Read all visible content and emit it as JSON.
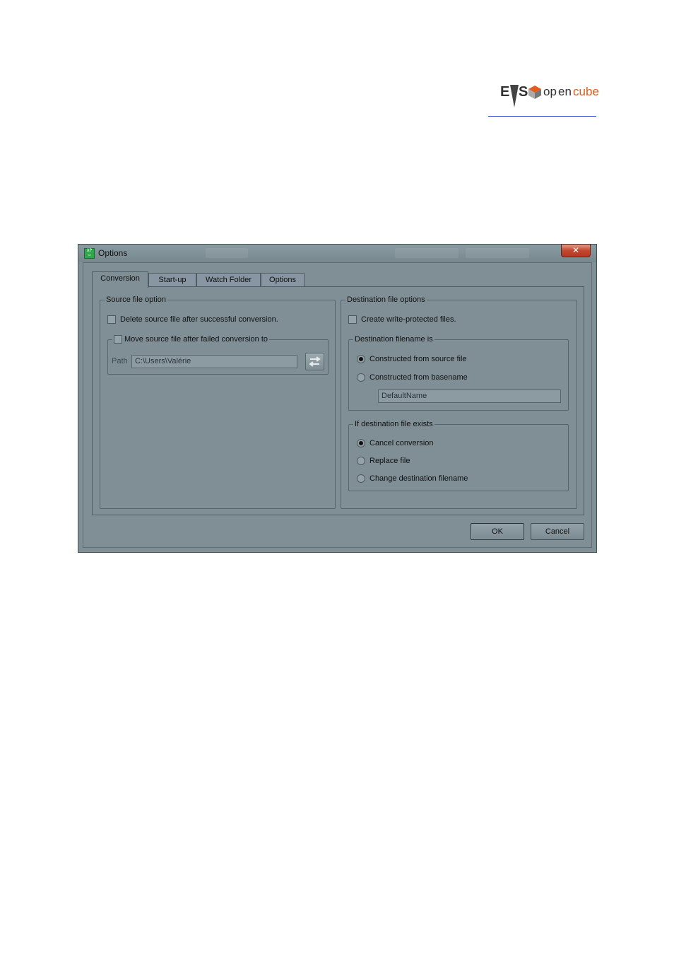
{
  "header": {
    "logo_alt": "EVS opencube"
  },
  "window": {
    "title": "Options",
    "close_label": "✕"
  },
  "tabs": [
    {
      "label": "Conversion",
      "active": true
    },
    {
      "label": "Start-up",
      "active": false
    },
    {
      "label": "Watch Folder",
      "active": false
    },
    {
      "label": "Options",
      "active": false
    }
  ],
  "source": {
    "group_label": "Source file option",
    "delete_label": "Delete source file after successful conversion.",
    "delete_checked": false,
    "move_label": "Move source file after failed conversion to",
    "move_checked": false,
    "path_label": "Path",
    "path_value": "C:\\Users\\Valérie"
  },
  "destination": {
    "group_label": "Destination file options",
    "write_protect_label": "Create write-protected files.",
    "write_protect_checked": false,
    "filename_group_label": "Destination filename is",
    "from_source_label": "Constructed from source file",
    "from_basename_label": "Constructed from basename",
    "selected_filename_mode": "source",
    "basename_value": "DefaultName",
    "exists_group_label": "If destination file exists",
    "cancel_label": "Cancel conversion",
    "replace_label": "Replace file",
    "change_label": "Change destination filename",
    "selected_exists_mode": "cancel"
  },
  "buttons": {
    "ok_label": "OK",
    "cancel_label": "Cancel"
  },
  "colors": {
    "window_bg": "#7f8f95",
    "close_red": "#c3472e",
    "logo_orange": "#e85a1a",
    "logo_dark": "#333333"
  }
}
